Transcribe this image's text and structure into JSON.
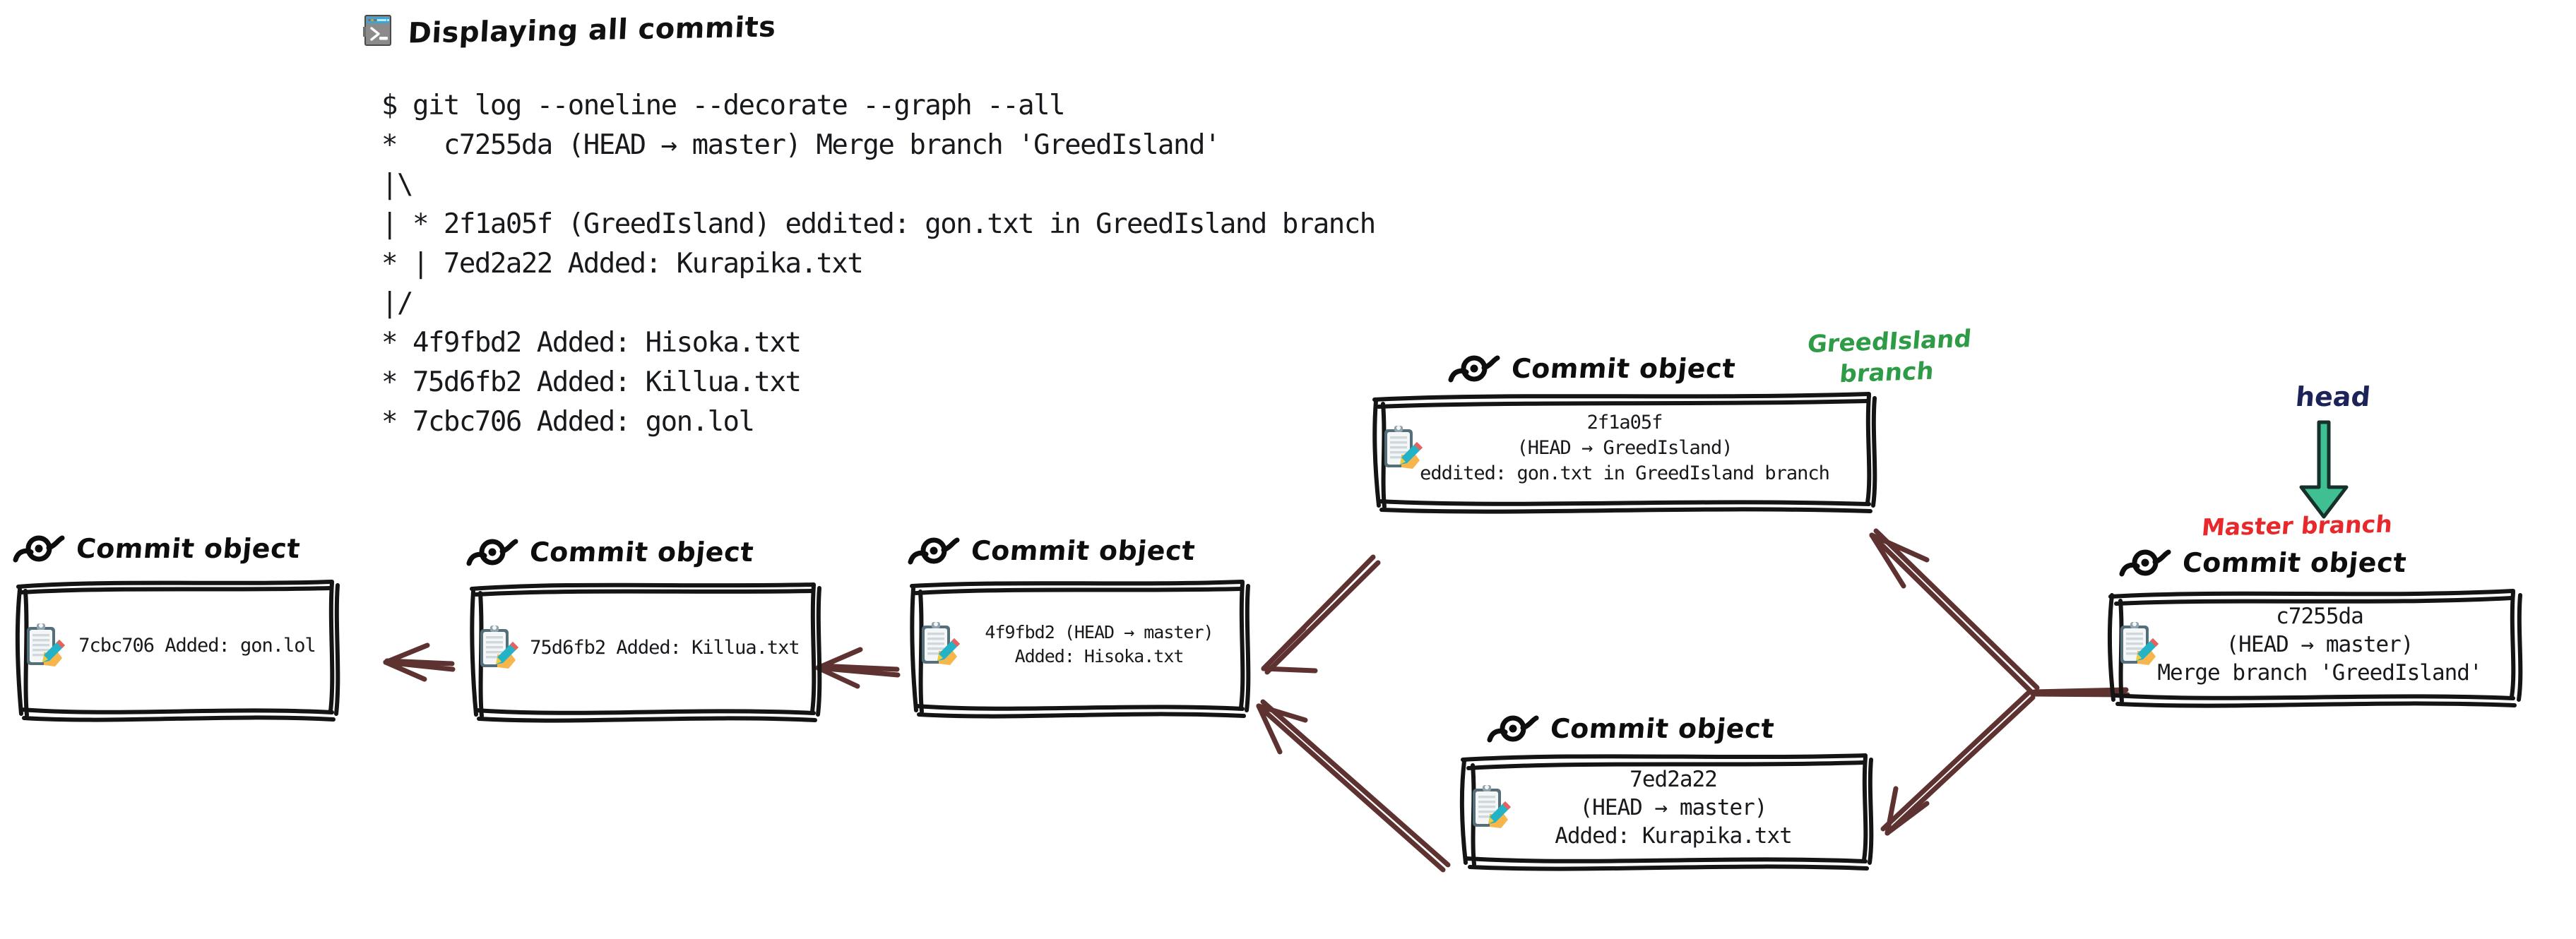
{
  "header": {
    "icon": "terminal-icon",
    "title": "Displaying all commits"
  },
  "terminal": {
    "prompt_symbol": "$",
    "command": "git log --oneline --decorate --graph --all",
    "log": "$ git log --oneline --decorate --graph --all\n*   c7255da (HEAD → master) Merge branch 'GreedIsland'\n|\\\n| * 2f1a05f (GreedIsland) eddited: gon.txt in GreedIsland branch\n* | 7ed2a22 Added: Kurapika.txt\n|/\n* 4f9fbd2 Added: Hisoka.txt\n* 75d6fb2 Added: Killua.txt\n* 7cbc706 Added: gon.lol",
    "lines": [
      "$ git log --oneline --decorate --graph --all",
      "*   c7255da (HEAD → master) Merge branch 'GreedIsland'",
      "|\\",
      "| * 2f1a05f (GreedIsland) eddited: gon.txt in GreedIsland branch",
      "* | 7ed2a22 Added: Kurapika.txt",
      "|/",
      "* 4f9fbd2 Added: Hisoka.txt",
      "* 75d6fb2 Added: Killua.txt",
      "* 7cbc706 Added: gon.lol"
    ]
  },
  "commit_label": "Commit object",
  "commits": [
    {
      "id": "gon",
      "hash": "7cbc706",
      "label": "Commit object",
      "text": "7cbc706 Added: gon.lol"
    },
    {
      "id": "killua",
      "hash": "75d6fb2",
      "label": "Commit object",
      "text": "75d6fb2 Added: Killua.txt"
    },
    {
      "id": "hisoka",
      "hash": "4f9fbd2",
      "label": "Commit object",
      "text": "4f9fbd2 (HEAD → master)\nAdded: Hisoka.txt"
    },
    {
      "id": "greedisland",
      "hash": "2f1a05f",
      "label": "Commit object",
      "text": "2f1a05f\n(HEAD → GreedIsland)\neddited: gon.txt in GreedIsland branch"
    },
    {
      "id": "kurapika",
      "hash": "7ed2a22",
      "label": "Commit object",
      "text": "7ed2a22\n(HEAD → master)\nAdded: Kurapika.txt"
    },
    {
      "id": "merge",
      "hash": "c7255da",
      "label": "Commit object",
      "text": "c7255da\n(HEAD → master)\nMerge branch 'GreedIsland'"
    }
  ],
  "annotations": {
    "greedisland_branch": "GreedIsland\nbranch",
    "head": "head",
    "master_branch": "Master branch"
  },
  "colors": {
    "arrow": "#5e3230",
    "branch_green": "#2e9b46",
    "head_navy": "#1c2358",
    "master_red": "#e8282a",
    "head_arrow_green": "#3fbf92",
    "ink": "#17191c",
    "background": "#ffffff"
  }
}
